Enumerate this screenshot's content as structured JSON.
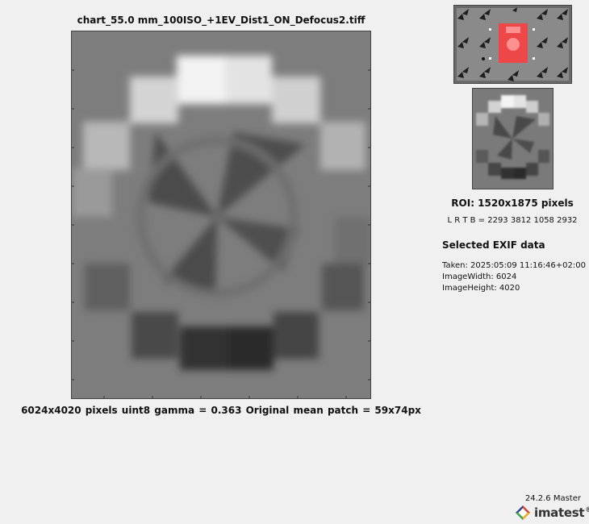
{
  "figure": {
    "title": "chart_55.0 mm_100ISO_+1EV_Dist1_ON_Defocus2.tiff",
    "caption": "6024x4020 pixels    uint8    gamma = 0.363   Original    mean patch = 59x74px"
  },
  "roi": {
    "title": "ROI:  1520x1875 pixels",
    "bounds": "L  R  T B = 2293 3812  1058 2932"
  },
  "exif": {
    "heading": "Selected EXIF data",
    "taken": "Taken: 2025:05:09 11:16:46+02:00",
    "image_width": "ImageWidth:  6024",
    "image_height": "ImageHeight:  4020"
  },
  "footer": {
    "version": "24.2.6 Master",
    "logo_text": "imatest",
    "logo_mark": "®"
  },
  "colors": {
    "background": "#f0f0f0",
    "roi_highlight": "#ff3b3b",
    "chart_gray": "#7a7a7a"
  }
}
